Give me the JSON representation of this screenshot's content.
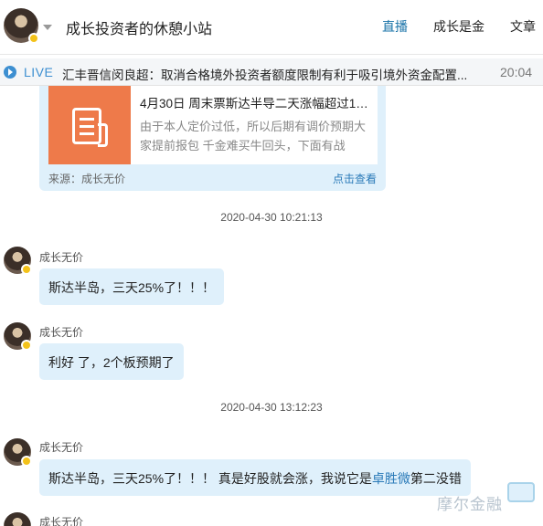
{
  "header": {
    "title": "成长投资者的休憩小站",
    "nav": [
      "直播",
      "成长是金",
      "文章"
    ],
    "active_index": 0
  },
  "live": {
    "label": "LIVE",
    "news": "汇丰晋信闵良超：取消合格境外投资者额度限制有利于吸引境外资金配置...",
    "time": "20:04"
  },
  "card": {
    "title": "4月30日 周末票斯达半导二天涨幅超过10...",
    "description": "由于本人定价过低，所以后期有调价预期大家提前报包 千金难买牛回头，下面有战",
    "source": "来源：成长无价",
    "link": "点击查看"
  },
  "timestamps": [
    "2020-04-30 10:21:13",
    "2020-04-30 13:12:23"
  ],
  "messages": [
    {
      "author": "成长无价",
      "text": "斯达半岛，三天25%了！！！"
    },
    {
      "author": "成长无价",
      "text": "利好 了，2个板预期了"
    },
    {
      "author": "成长无价",
      "text_before": "斯达半岛，三天25%了！！！ 真是好股就会涨，我说它是",
      "highlight": "卓胜微",
      "text_after": "第二没错"
    },
    {
      "author": "成长无价"
    }
  ],
  "watermark": "摩尔金融",
  "colors": {
    "accent": "#1a73a8",
    "bubble": "#dff0fb",
    "thumb": "#ee7a4a",
    "live": "#3d8fd1"
  }
}
